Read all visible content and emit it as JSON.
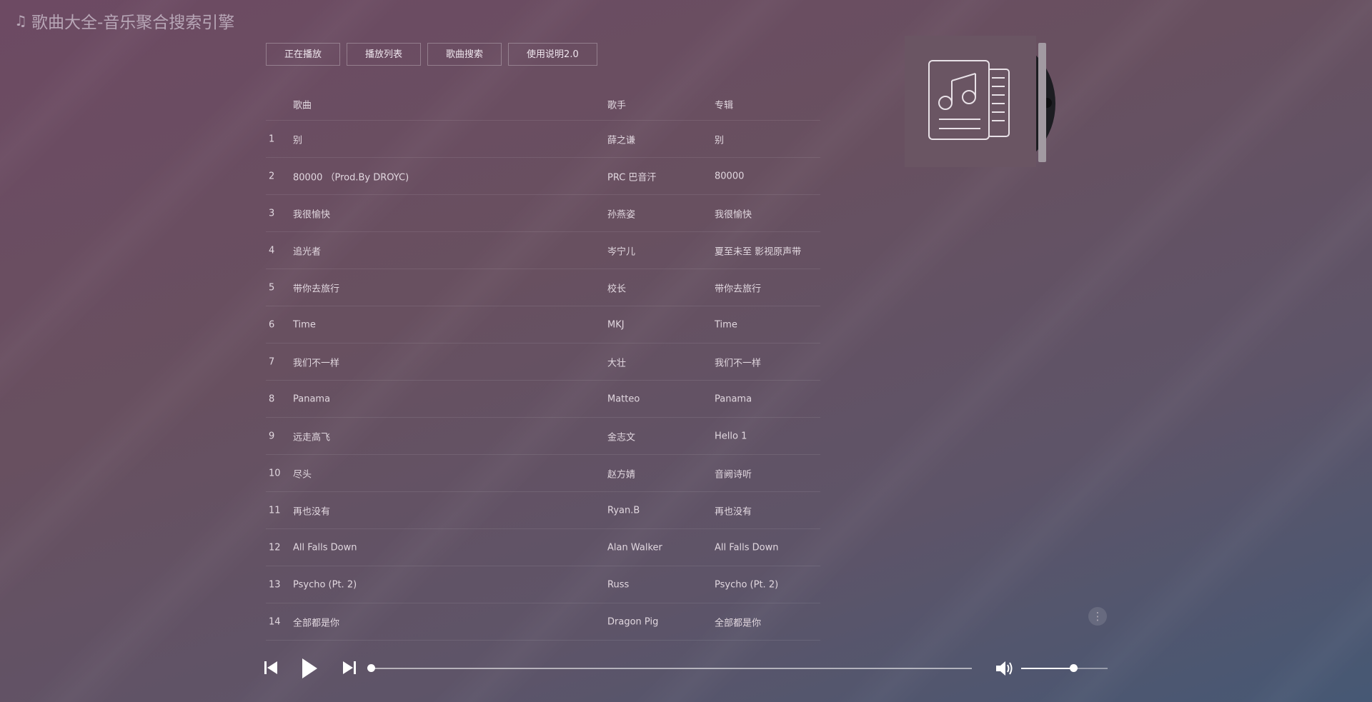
{
  "app": {
    "title": "歌曲大全-音乐聚合搜索引擎",
    "title_icon": "music-note-icon"
  },
  "tabs": [
    {
      "label": "正在播放"
    },
    {
      "label": "播放列表"
    },
    {
      "label": "歌曲搜索"
    },
    {
      "label": "使用说明2.0"
    }
  ],
  "table": {
    "headers": {
      "song": "歌曲",
      "artist": "歌手",
      "album": "专辑"
    },
    "rows": [
      {
        "idx": "1",
        "song": "别",
        "artist": "薛之谦",
        "album": "别"
      },
      {
        "idx": "2",
        "song": "80000 （Prod.By DROYC)",
        "artist": "PRC 巴音汗",
        "album": "80000"
      },
      {
        "idx": "3",
        "song": "我很愉快",
        "artist": "孙燕姿",
        "album": "我很愉快"
      },
      {
        "idx": "4",
        "song": "追光者",
        "artist": "岑宁儿",
        "album": "夏至未至 影视原声带"
      },
      {
        "idx": "5",
        "song": "带你去旅行",
        "artist": "校长",
        "album": "带你去旅行"
      },
      {
        "idx": "6",
        "song": "Time",
        "artist": "MKJ",
        "album": "Time"
      },
      {
        "idx": "7",
        "song": "我们不一样",
        "artist": "大壮",
        "album": "我们不一样"
      },
      {
        "idx": "8",
        "song": "Panama",
        "artist": "Matteo",
        "album": "Panama"
      },
      {
        "idx": "9",
        "song": "远走高飞",
        "artist": "金志文",
        "album": "Hello 1"
      },
      {
        "idx": "10",
        "song": "尽头",
        "artist": "赵方婧",
        "album": "音阙诗听"
      },
      {
        "idx": "11",
        "song": "再也没有",
        "artist": "Ryan.B",
        "album": "再也没有"
      },
      {
        "idx": "12",
        "song": "All Falls Down",
        "artist": "Alan Walker",
        "album": "All Falls Down"
      },
      {
        "idx": "13",
        "song": "Psycho (Pt. 2)",
        "artist": "Russ",
        "album": "Psycho (Pt. 2)"
      },
      {
        "idx": "14",
        "song": "全部都是你",
        "artist": "Dragon Pig",
        "album": "全部都是你"
      }
    ]
  },
  "cover": {
    "icon": "music-document-icon"
  },
  "player": {
    "progress": 0,
    "volume": 0.6,
    "icons": {
      "prev": "skip-previous-icon",
      "play": "play-icon",
      "next": "skip-next-icon",
      "volume": "volume-icon",
      "menu": "more-vertical-icon"
    }
  },
  "colors": {
    "background_start": "#6d4a63",
    "background_end": "#465874",
    "text": "#e1d7df",
    "title": "#b7a6b6"
  }
}
